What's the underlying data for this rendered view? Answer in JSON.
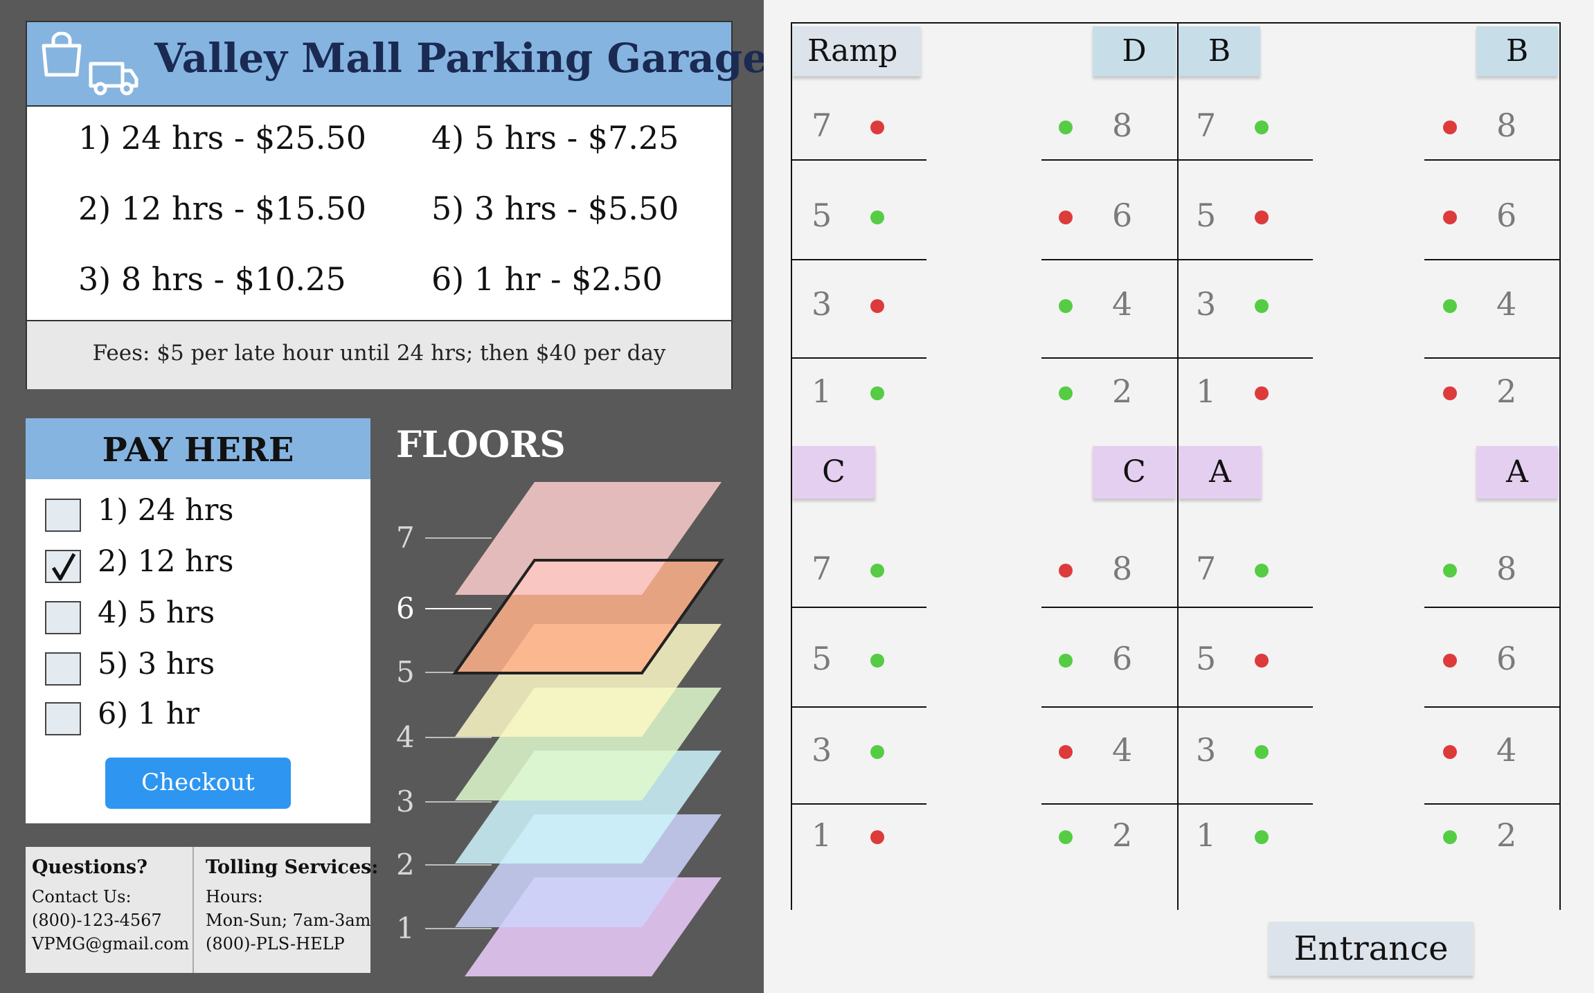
{
  "header": {
    "title": "Valley Mall Parking Garage",
    "icons": [
      "shopping-bag-icon",
      "truck-icon"
    ]
  },
  "rates": [
    "1) 24 hrs - $25.50",
    "4) 5 hrs - $7.25",
    "2) 12 hrs - $15.50",
    "5) 3 hrs - $5.50",
    "3) 8 hrs - $10.25",
    "6) 1 hr - $2.50"
  ],
  "fees": "Fees: $5 per late hour until 24 hrs; then $40 per day",
  "pay": {
    "title": "PAY HERE",
    "options": [
      {
        "label": "1) 24 hrs",
        "checked": false
      },
      {
        "label": "2) 12 hrs",
        "checked": true
      },
      {
        "label": "4) 5 hrs",
        "checked": false
      },
      {
        "label": "5) 3 hrs",
        "checked": false
      },
      {
        "label": "6) 1 hr",
        "checked": false
      }
    ],
    "checkout": "Checkout"
  },
  "info": {
    "questions": {
      "title": "Questions?",
      "lines": [
        "Contact Us:",
        "(800)-123-4567",
        "VPMG@gmail.com"
      ]
    },
    "tolling": {
      "title": "Tolling Services:",
      "lines": [
        "Hours:",
        "Mon-Sun; 7am-3am",
        "(800)-PLS-HELP"
      ]
    }
  },
  "floors": {
    "title": "FLOORS",
    "numbers": [
      "7",
      "6",
      "5",
      "4",
      "3",
      "2",
      "1"
    ],
    "selected": "6",
    "colors": [
      "#fdcccc",
      "#ffb08a",
      "#fdf8c6",
      "#dff9cc",
      "#cdf4fc",
      "#cdd3fb",
      "#eccdfd"
    ]
  },
  "map": {
    "ramp_label": "Ramp",
    "section_labels": {
      "top": [
        "D",
        "B",
        "B"
      ],
      "bottom": [
        "C",
        "C",
        "A",
        "A"
      ]
    },
    "status_colors": {
      "available": "#55cc44",
      "occupied": "#dd3b3b"
    },
    "spots": {
      "top": [
        [
          "7",
          "occupied",
          "available",
          "8",
          "7",
          "available",
          "occupied",
          "8"
        ],
        [
          "5",
          "available",
          "occupied",
          "6",
          "5",
          "occupied",
          "occupied",
          "6"
        ],
        [
          "3",
          "occupied",
          "available",
          "4",
          "3",
          "available",
          "available",
          "4"
        ],
        [
          "1",
          "available",
          "available",
          "2",
          "1",
          "occupied",
          "occupied",
          "2"
        ]
      ],
      "bottom": [
        [
          "7",
          "available",
          "occupied",
          "8",
          "7",
          "available",
          "available",
          "8"
        ],
        [
          "5",
          "available",
          "available",
          "6",
          "5",
          "occupied",
          "occupied",
          "6"
        ],
        [
          "3",
          "available",
          "occupied",
          "4",
          "3",
          "available",
          "occupied",
          "4"
        ],
        [
          "1",
          "occupied",
          "available",
          "2",
          "1",
          "available",
          "available",
          "2"
        ]
      ]
    },
    "entrance": "Entrance"
  }
}
